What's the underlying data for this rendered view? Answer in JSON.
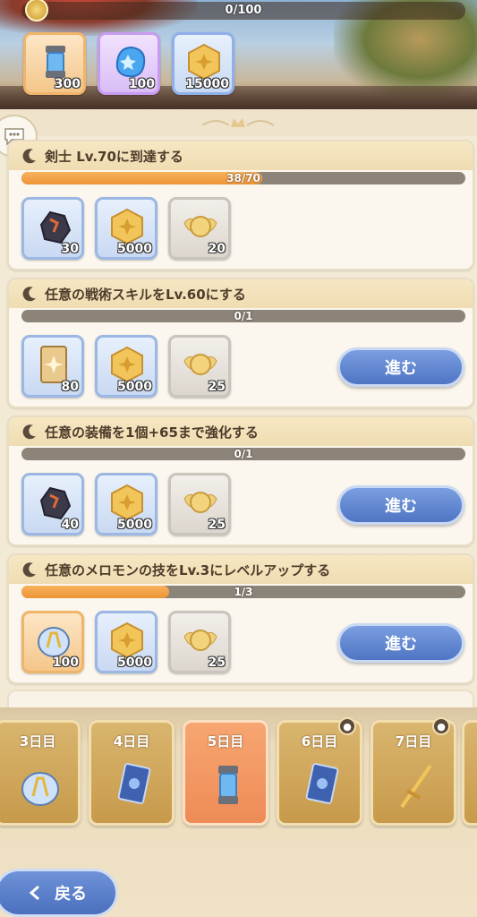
{
  "top": {
    "progress_text": "0/100",
    "rewards": [
      {
        "icon": "capsule-icon",
        "count": "300",
        "rarity": "orange"
      },
      {
        "icon": "crystal-icon",
        "count": "100",
        "rarity": "purple"
      },
      {
        "icon": "gold-coin-icon",
        "count": "15000",
        "rarity": "blue"
      }
    ]
  },
  "missions": [
    {
      "title": "剣士 Lv.70に到達する",
      "progress_text": "38/70",
      "progress": 0.543,
      "rewards": [
        {
          "icon": "ore-icon",
          "count": "30",
          "rarity": "blue"
        },
        {
          "icon": "gold-coin-icon",
          "count": "5000",
          "rarity": "blue"
        },
        {
          "icon": "wing-medal-icon",
          "count": "20",
          "rarity": "gray"
        }
      ],
      "button_label": ""
    },
    {
      "title": "任意の戦術スキルをLv.60にする",
      "progress_text": "0/1",
      "progress": 0,
      "rewards": [
        {
          "icon": "skill-card-icon",
          "count": "80",
          "rarity": "blue"
        },
        {
          "icon": "gold-coin-icon",
          "count": "5000",
          "rarity": "blue"
        },
        {
          "icon": "wing-medal-icon",
          "count": "25",
          "rarity": "gray"
        }
      ],
      "button_label": "進む"
    },
    {
      "title": "任意の装備を1個+65まで強化する",
      "progress_text": "0/1",
      "progress": 0,
      "rewards": [
        {
          "icon": "ore-icon",
          "count": "40",
          "rarity": "blue"
        },
        {
          "icon": "gold-coin-icon",
          "count": "5000",
          "rarity": "blue"
        },
        {
          "icon": "wing-medal-icon",
          "count": "25",
          "rarity": "gray"
        }
      ],
      "button_label": "進む"
    },
    {
      "title": "任意のメロモンの技をLv.3にレベルアップする",
      "progress_text": "1/3",
      "progress": 0.333,
      "rewards": [
        {
          "icon": "rune-orb-icon",
          "count": "100",
          "rarity": "orange"
        },
        {
          "icon": "gold-coin-icon",
          "count": "5000",
          "rarity": "blue"
        },
        {
          "icon": "wing-medal-icon",
          "count": "25",
          "rarity": "gray"
        }
      ],
      "button_label": "進む"
    }
  ],
  "days": [
    {
      "label": "3日目",
      "icon": "rune-orb-icon",
      "locked": false,
      "active": false
    },
    {
      "label": "4日目",
      "icon": "blue-card-icon",
      "locked": false,
      "active": false
    },
    {
      "label": "5日目",
      "icon": "capsule-icon",
      "locked": false,
      "active": true
    },
    {
      "label": "6日目",
      "icon": "blue-card-icon",
      "locked": true,
      "active": false
    },
    {
      "label": "7日目",
      "icon": "golden-sword-icon",
      "locked": true,
      "active": false
    }
  ],
  "back_label": "戻る"
}
